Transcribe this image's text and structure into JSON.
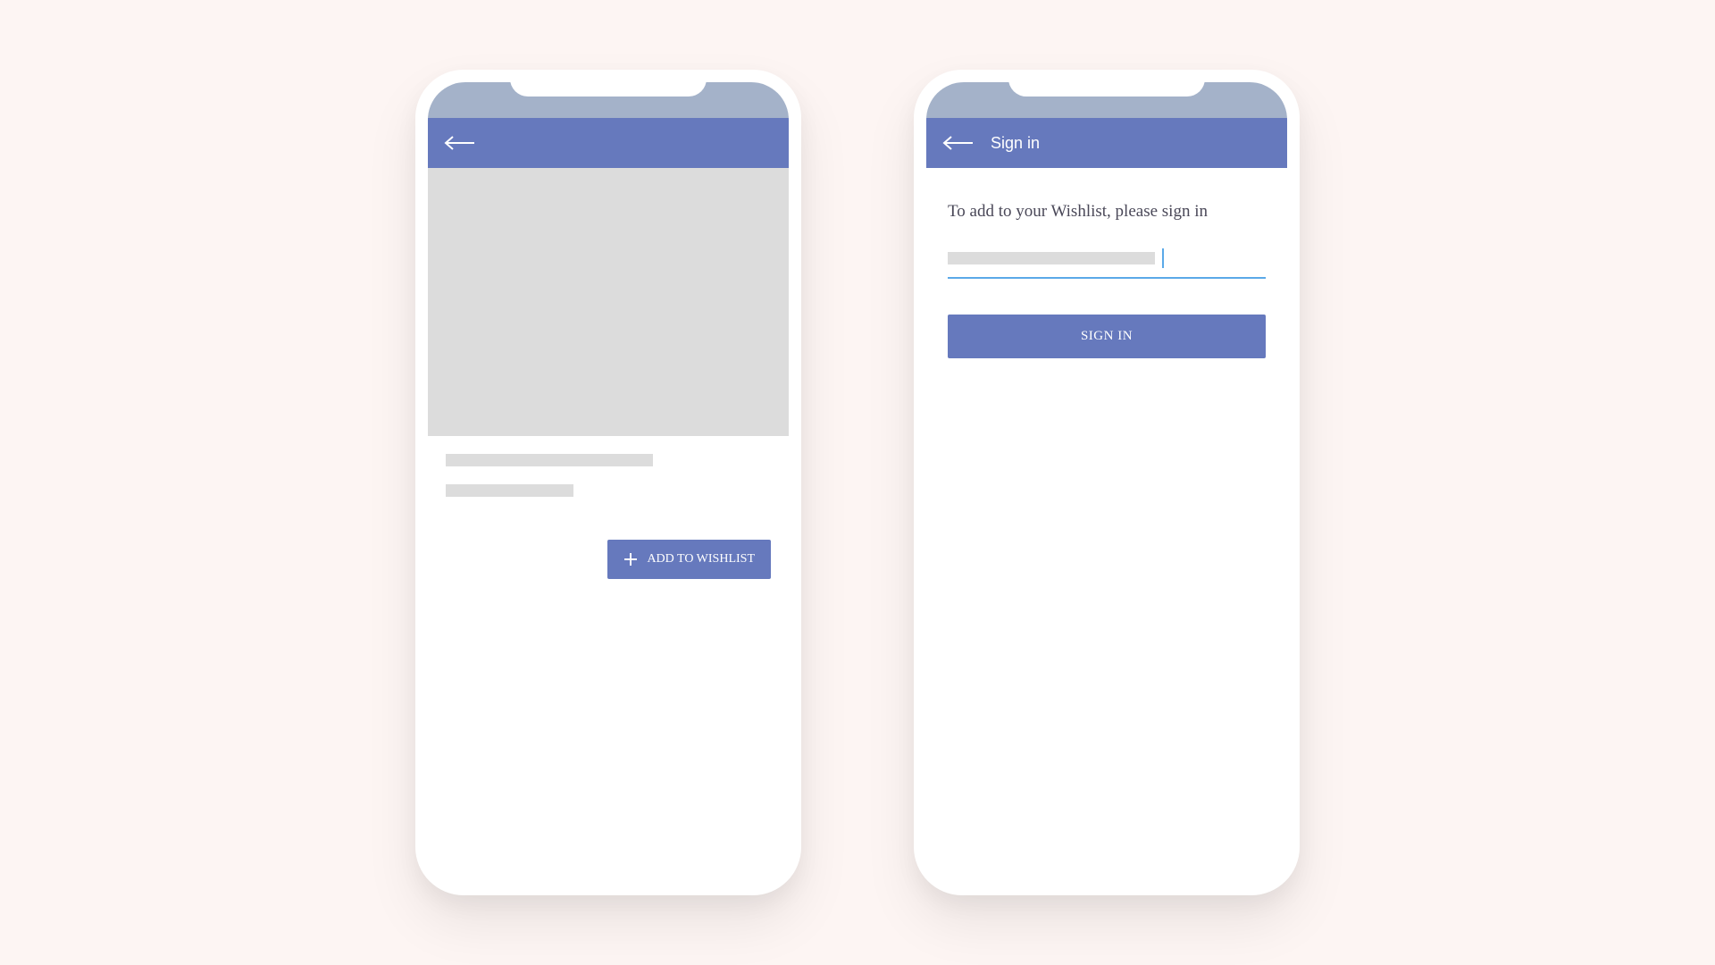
{
  "screen1": {
    "addToWishlistLabel": "ADD TO WISHLIST"
  },
  "screen2": {
    "appBarTitle": "Sign in",
    "message": "To add to your Wishlist, please sign in",
    "signInButtonLabel": "SIGN IN"
  }
}
